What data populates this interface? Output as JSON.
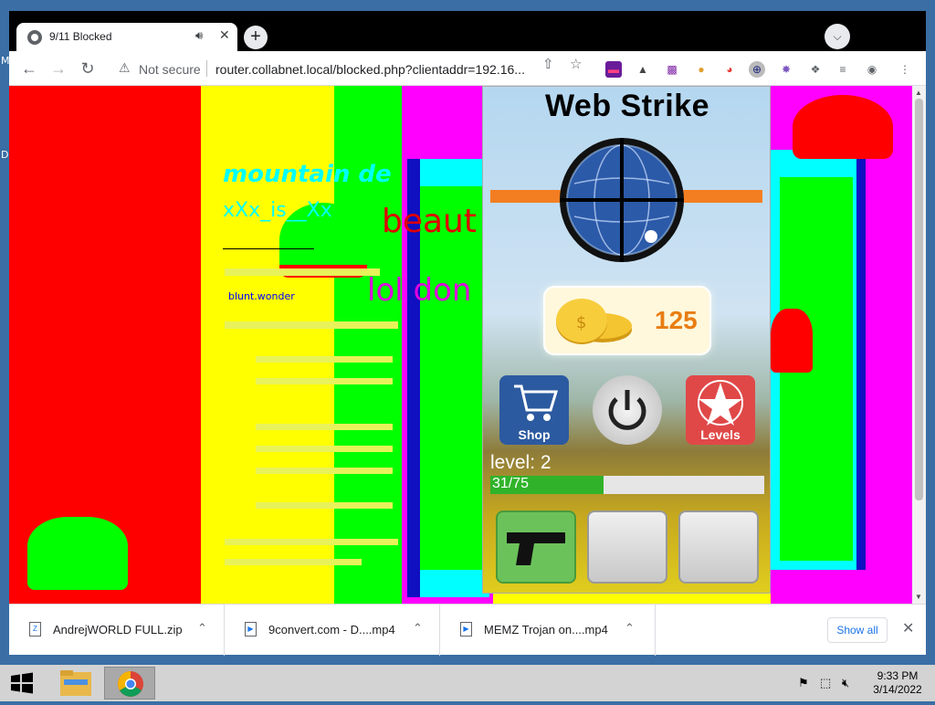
{
  "desktop": {
    "edge_glyphs": [
      "M",
      "D"
    ]
  },
  "browser": {
    "tab": {
      "title": "9/11 Blocked"
    },
    "toolbar": {
      "security_label": "Not secure",
      "url": "router.collabnet.local/blocked.php?clientaddr=192.16..."
    },
    "page": {
      "heading": "mountain de",
      "subheading": "xXx_is__Xx",
      "overlay_text_1": "beaut",
      "overlay_text_2": "lol don",
      "line_a": "blunt.wonder"
    },
    "downloads": {
      "items": [
        {
          "name": "AndrejWORLD FULL.zip"
        },
        {
          "name": "9convert.com - D....mp4"
        },
        {
          "name": "MEMZ Trojan on....mp4"
        }
      ],
      "show_all_label": "Show all"
    }
  },
  "web_strike": {
    "title": "Web Strike",
    "coins": "125",
    "buttons": [
      {
        "label": "Shop",
        "color": "#2c5aa0"
      },
      {
        "label": "",
        "color": "#cfcfcf"
      },
      {
        "label": "Levels",
        "color": "#e04848"
      }
    ],
    "level_label": "level: 2",
    "progress_text": "31/75",
    "progress_fraction": 0.413,
    "slots": [
      "pistol",
      "",
      ""
    ]
  },
  "taskbar": {
    "time": "9:33 PM",
    "date": "3/14/2022"
  }
}
